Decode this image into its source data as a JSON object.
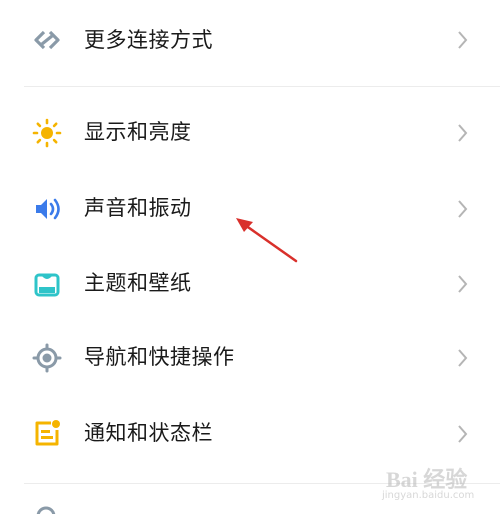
{
  "settings": {
    "items": [
      {
        "label": "更多连接方式",
        "icon": "link-icon",
        "color": "#8a9aa8"
      },
      {
        "label": "显示和亮度",
        "icon": "sun-icon",
        "color": "#f5b400"
      },
      {
        "label": "声音和振动",
        "icon": "speaker-icon",
        "color": "#3b7bea"
      },
      {
        "label": "主题和壁纸",
        "icon": "theme-icon",
        "color": "#2ec4c9"
      },
      {
        "label": "导航和快捷操作",
        "icon": "navigation-icon",
        "color": "#8a9aa8"
      },
      {
        "label": "通知和状态栏",
        "icon": "notification-icon",
        "color": "#f5b400"
      }
    ]
  },
  "annotation": {
    "arrow_color": "#d9302b"
  },
  "watermark": {
    "brand": "Bai 经验",
    "url": "jingyan.baidu.com"
  }
}
